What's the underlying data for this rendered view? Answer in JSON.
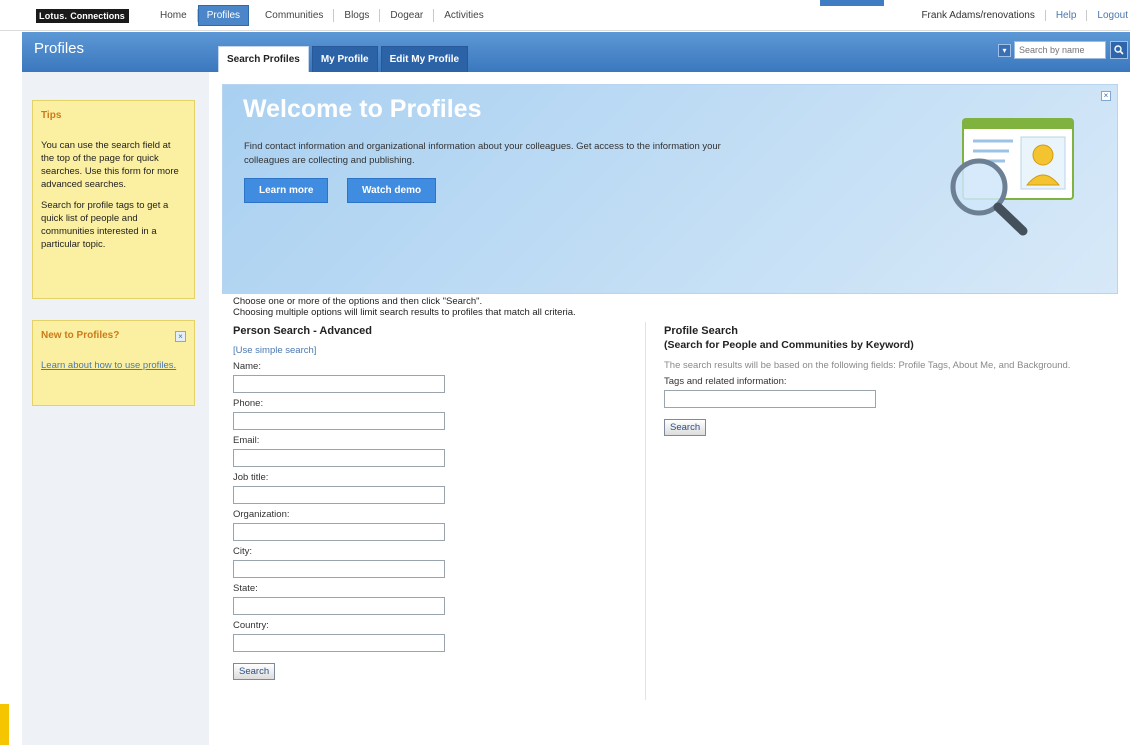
{
  "topnav": {
    "logo_lotus": "Lotus.",
    "logo_product": "Connections",
    "items": [
      "Home",
      "Profiles",
      "Communities",
      "Blogs",
      "Dogear",
      "Activities"
    ],
    "active_index": 1,
    "user": "Frank Adams/renovations",
    "help": "Help",
    "logout": "Logout"
  },
  "header": {
    "title": "Profiles",
    "tabs": [
      "Search Profiles",
      "My Profile",
      "Edit My Profile"
    ],
    "active_tab": 0,
    "search_placeholder": "Search by name"
  },
  "sidebar": {
    "tips_title": "Tips",
    "tips_text_1": "You can use the search field at the top of the page for quick searches. Use this form for more advanced searches.",
    "tips_text_2": "Search for profile tags to get a quick list of people and communities interested in a particular topic.",
    "new_title": "New to Profiles?",
    "new_link": "Learn about how to use profiles."
  },
  "banner": {
    "title": "Welcome to Profiles",
    "text": "Find contact information and organizational information about your colleagues. Get access to the information your colleagues are collecting and publishing.",
    "learn_more": "Learn more",
    "watch_demo": "Watch demo"
  },
  "intro": {
    "line1": "Choose one or more of the options and then click \"Search\".",
    "line2": "Choosing multiple options will limit search results to profiles that match all criteria."
  },
  "person_search": {
    "title": "Person Search - Advanced",
    "simple_link": "[Use simple search]",
    "fields": [
      "Name:",
      "Phone:",
      "Email:",
      "Job title:",
      "Organization:",
      "City:",
      "State:",
      "Country:"
    ],
    "button": "Search"
  },
  "profile_search": {
    "title": "Profile Search",
    "subtitle": "(Search for People and Communities by Keyword)",
    "description": "The search results will be based on the following fields: Profile Tags, About Me, and Background.",
    "field_label": "Tags and related information:",
    "button": "Search"
  }
}
